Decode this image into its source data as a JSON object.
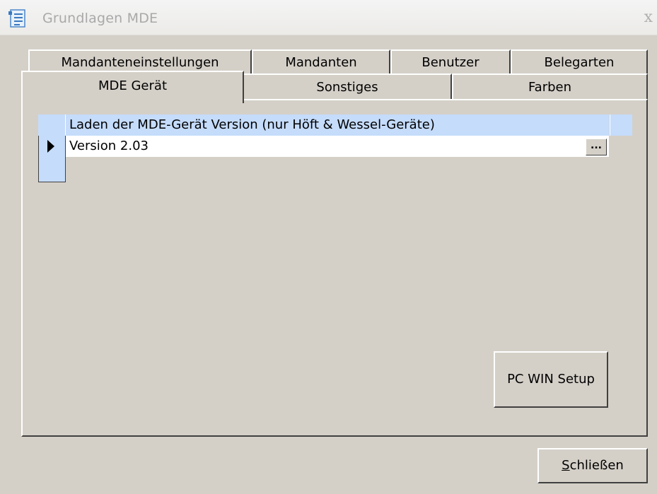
{
  "window": {
    "title": "Grundlagen MDE",
    "close_glyph": "x",
    "icon": "list-document-icon"
  },
  "tabs": {
    "row1": [
      "Mandanteneinstellungen",
      "Mandanten",
      "Benutzer",
      "Belegarten"
    ],
    "row2": [
      "MDE Gerät",
      "Sonstiges",
      "Farben"
    ],
    "active": "MDE Gerät"
  },
  "grid": {
    "header": "Laden der MDE-Gerät Version (nur Höft & Wessel-Geräte)",
    "rows": [
      {
        "value": "Version 2.03",
        "button_label": "..."
      }
    ]
  },
  "buttons": {
    "pc_win_setup": "PC WIN Setup",
    "close_mnemonic": "S",
    "close_rest": "chließen"
  },
  "colors": {
    "face": "#d4d0c8",
    "grid_header": "#c5dcfb"
  }
}
